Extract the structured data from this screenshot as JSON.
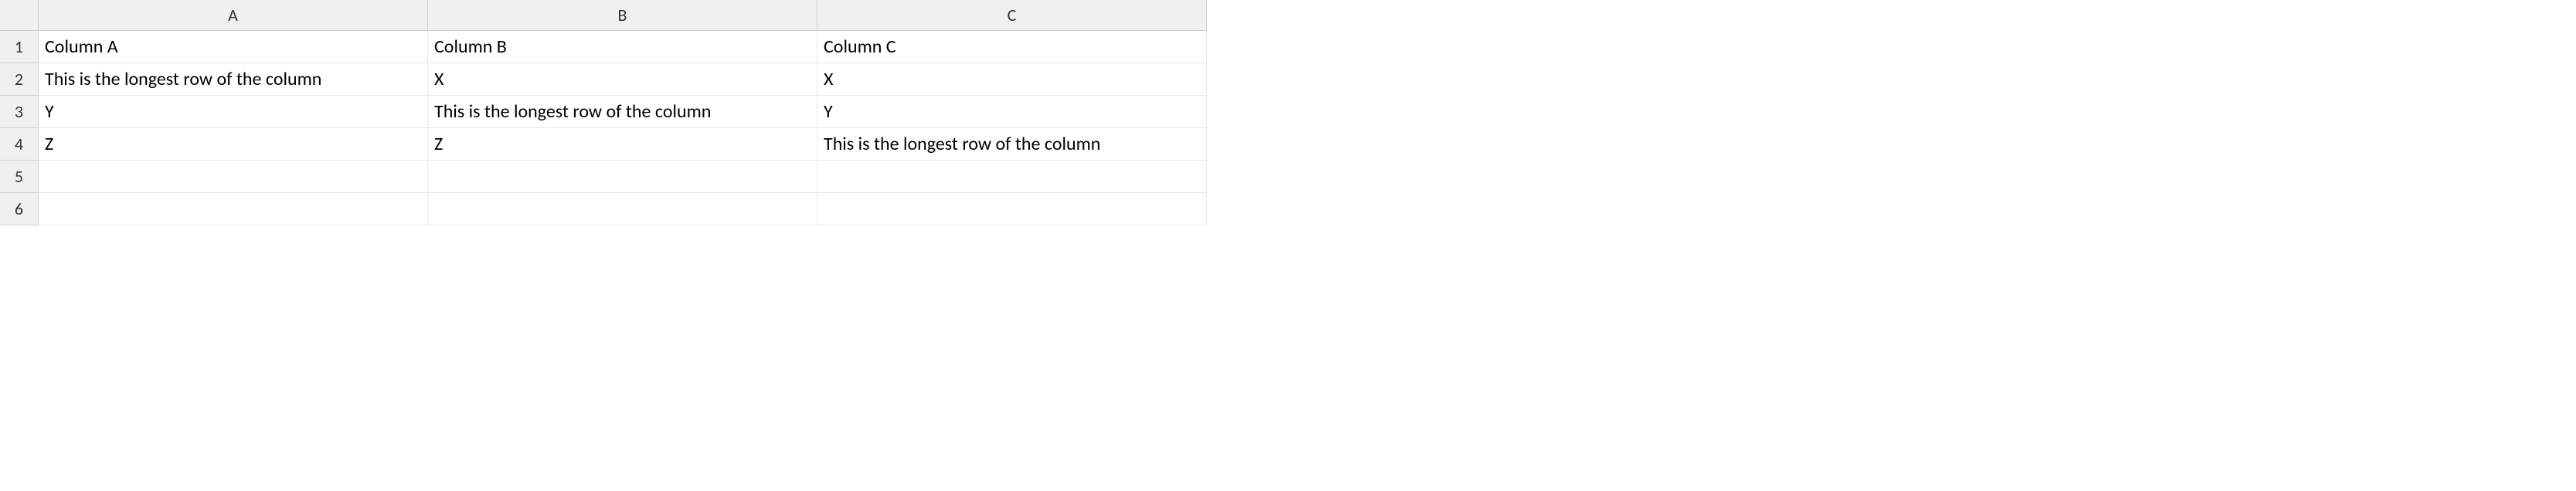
{
  "columns": {
    "A": "A",
    "B": "B",
    "C": "C"
  },
  "rows": {
    "1": "1",
    "2": "2",
    "3": "3",
    "4": "4",
    "5": "5",
    "6": "6"
  },
  "cells": {
    "A1": "Column A",
    "B1": "Column B",
    "C1": "Column C",
    "A2": "This is the longest row of the column",
    "B2": "X",
    "C2": "X",
    "A3": "Y",
    "B3": "This is the longest row of the column",
    "C3": "Y",
    "A4": "Z",
    "B4": "Z",
    "C4": "This is the longest row of the column",
    "A5": "",
    "B5": "",
    "C5": "",
    "A6": "",
    "B6": "",
    "C6": ""
  }
}
